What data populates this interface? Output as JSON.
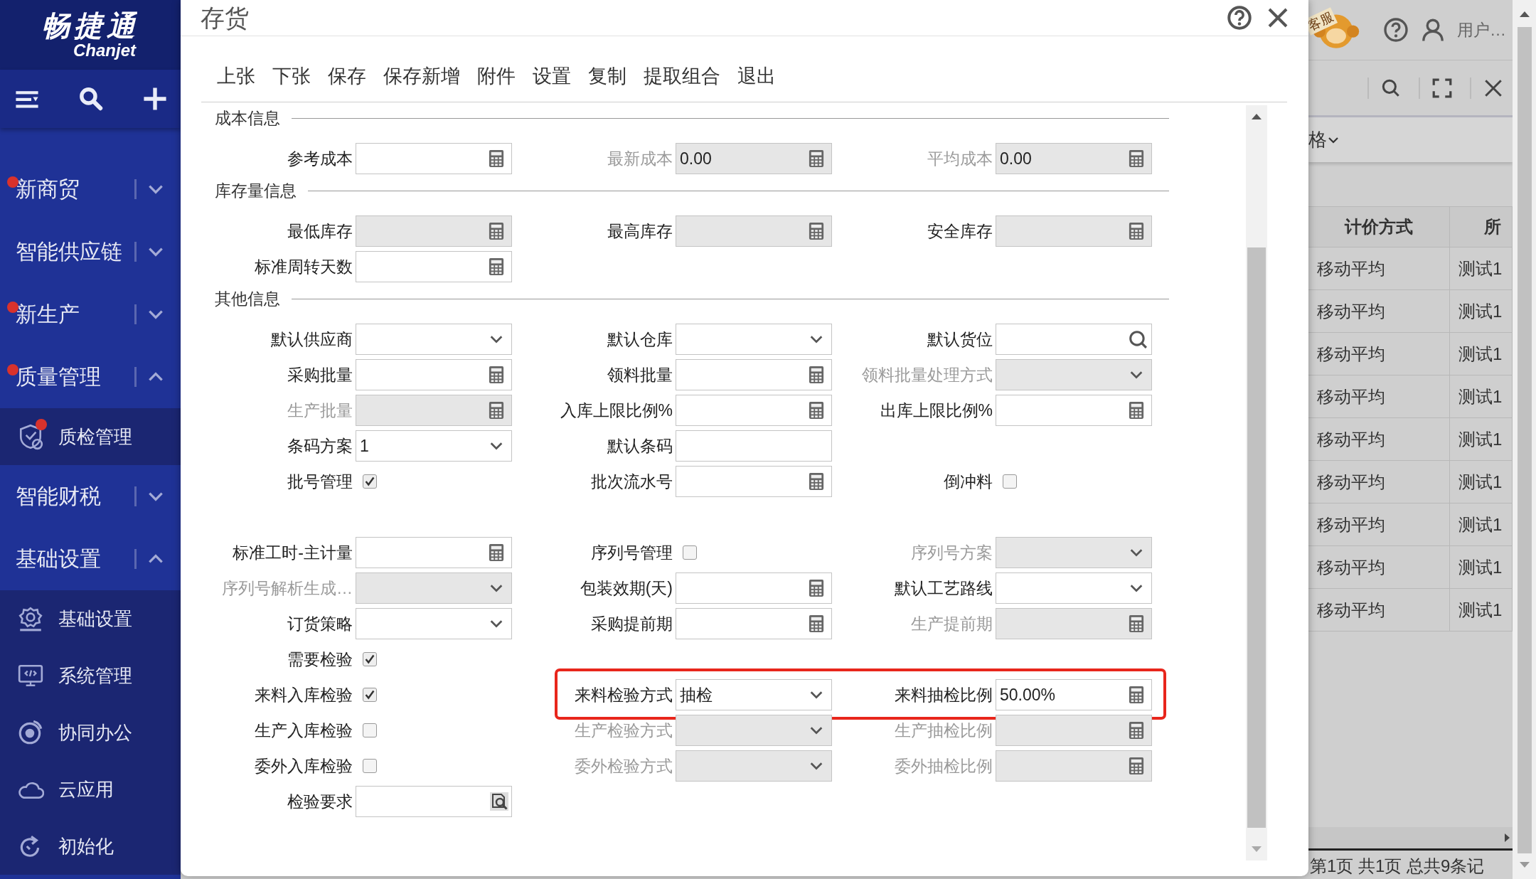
{
  "sidebar": {
    "logo": {
      "title": "畅捷通",
      "subtitle": "Chanjet"
    },
    "items": [
      {
        "label": "新商贸",
        "badge": true,
        "expanded": false
      },
      {
        "label": "智能供应链",
        "badge": false,
        "expanded": false
      },
      {
        "label": "新生产",
        "badge": true,
        "expanded": false
      },
      {
        "label": "质量管理",
        "badge": true,
        "expanded": true,
        "children": [
          {
            "label": "质检管理",
            "badge": true
          }
        ]
      },
      {
        "label": "智能财税",
        "badge": false,
        "expanded": false
      },
      {
        "label": "基础设置",
        "badge": false,
        "expanded": true,
        "children": [
          {
            "label": "基础设置",
            "badge": false
          },
          {
            "label": "系统管理",
            "badge": false
          },
          {
            "label": "协同办公",
            "badge": false
          },
          {
            "label": "云应用",
            "badge": false
          },
          {
            "label": "初始化",
            "badge": false
          }
        ]
      }
    ]
  },
  "dialog": {
    "title": "存货",
    "toolbar": [
      "上张",
      "下张",
      "保存",
      "保存新增",
      "附件",
      "设置",
      "复制",
      "提取组合",
      "退出"
    ],
    "sections": [
      {
        "title": "成本信息",
        "rows": [
          {
            "kind": "fields",
            "highlighted": false,
            "cells": [
              {
                "kind": "calc",
                "label": "参考成本",
                "disabled": false,
                "readonly": false
              },
              {
                "kind": "calc",
                "label": "最新成本",
                "value": "0.00",
                "disabled": true,
                "readonly": true
              },
              {
                "kind": "calc",
                "label": "平均成本",
                "value": "0.00",
                "disabled": true,
                "readonly": true
              }
            ]
          }
        ]
      },
      {
        "title": "库存量信息",
        "rows": [
          {
            "kind": "fields",
            "highlighted": false,
            "cells": [
              {
                "kind": "calc",
                "label": "最低库存",
                "disabled": false,
                "readonly": true
              },
              {
                "kind": "calc",
                "label": "最高库存",
                "disabled": false,
                "readonly": true
              },
              {
                "kind": "calc",
                "label": "安全库存",
                "disabled": false,
                "readonly": true
              }
            ]
          },
          {
            "kind": "fields",
            "highlighted": false,
            "cells": [
              {
                "kind": "calc",
                "label": "标准周转天数",
                "disabled": false,
                "readonly": false
              },
              {
                "kind": "empty"
              },
              {
                "kind": "empty"
              }
            ]
          }
        ]
      },
      {
        "title": "其他信息",
        "rows": [
          {
            "kind": "fields",
            "highlighted": false,
            "cells": [
              {
                "kind": "select",
                "label": "默认供应商",
                "disabled": false,
                "readonly": false
              },
              {
                "kind": "select",
                "label": "默认仓库",
                "disabled": false,
                "readonly": false
              },
              {
                "kind": "search",
                "label": "默认货位",
                "disabled": false,
                "readonly": false
              }
            ]
          },
          {
            "kind": "fields",
            "highlighted": false,
            "cells": [
              {
                "kind": "calc",
                "label": "采购批量",
                "disabled": false,
                "readonly": false
              },
              {
                "kind": "calc",
                "label": "领料批量",
                "disabled": false,
                "readonly": false
              },
              {
                "kind": "select",
                "label": "领料批量处理方式",
                "disabled": true,
                "readonly": true
              }
            ]
          },
          {
            "kind": "fields",
            "highlighted": false,
            "cells": [
              {
                "kind": "calc",
                "label": "生产批量",
                "disabled": true,
                "readonly": true
              },
              {
                "kind": "calc",
                "label": "入库上限比例%",
                "disabled": false,
                "readonly": false
              },
              {
                "kind": "calc",
                "label": "出库上限比例%",
                "disabled": false,
                "readonly": false
              }
            ]
          },
          {
            "kind": "fields",
            "highlighted": false,
            "cells": [
              {
                "kind": "select",
                "label": "条码方案",
                "value": "1",
                "disabled": false,
                "readonly": false
              },
              {
                "kind": "text",
                "label": "默认条码",
                "disabled": false,
                "readonly": false
              },
              {
                "kind": "empty"
              }
            ]
          },
          {
            "kind": "fields",
            "highlighted": false,
            "cells": [
              {
                "kind": "checkbox",
                "label": "批号管理",
                "checked": true
              },
              {
                "kind": "calc",
                "label": "批次流水号",
                "disabled": false,
                "readonly": false
              },
              {
                "kind": "checkbox",
                "label": "倒冲料",
                "checked": false
              }
            ]
          },
          {
            "kind": "spacer"
          },
          {
            "kind": "fields",
            "highlighted": false,
            "cells": [
              {
                "kind": "calc",
                "label": "标准工时-主计量",
                "disabled": false,
                "readonly": false
              },
              {
                "kind": "checkbox",
                "label": "序列号管理",
                "checked": false
              },
              {
                "kind": "select",
                "label": "序列号方案",
                "disabled": true,
                "readonly": true
              }
            ]
          },
          {
            "kind": "fields",
            "highlighted": false,
            "cells": [
              {
                "kind": "select",
                "label": "序列号解析生成…",
                "disabled": true,
                "readonly": true
              },
              {
                "kind": "calc",
                "label": "包装效期(天)",
                "disabled": false,
                "readonly": false
              },
              {
                "kind": "select",
                "label": "默认工艺路线",
                "disabled": false,
                "readonly": false
              }
            ]
          },
          {
            "kind": "fields",
            "highlighted": false,
            "cells": [
              {
                "kind": "select",
                "label": "订货策略",
                "disabled": false,
                "readonly": false
              },
              {
                "kind": "calc",
                "label": "采购提前期",
                "disabled": false,
                "readonly": false
              },
              {
                "kind": "calc",
                "label": "生产提前期",
                "disabled": true,
                "readonly": true
              }
            ]
          },
          {
            "kind": "fields",
            "highlighted": false,
            "cells": [
              {
                "kind": "checkbox",
                "label": "需要检验",
                "checked": true
              },
              {
                "kind": "empty"
              },
              {
                "kind": "empty"
              }
            ]
          },
          {
            "kind": "fields",
            "highlighted": true,
            "cells": [
              {
                "kind": "checkbox",
                "label": "来料入库检验",
                "checked": true
              },
              {
                "kind": "select",
                "label": "来料检验方式",
                "value": "抽检",
                "disabled": false,
                "readonly": false
              },
              {
                "kind": "calc",
                "label": "来料抽检比例",
                "value": "50.00%",
                "disabled": false,
                "readonly": false
              }
            ]
          },
          {
            "kind": "fields",
            "highlighted": false,
            "cells": [
              {
                "kind": "checkbox",
                "label": "生产入库检验",
                "checked": false
              },
              {
                "kind": "select",
                "label": "生产检验方式",
                "disabled": true,
                "readonly": true
              },
              {
                "kind": "calc",
                "label": "生产抽检比例",
                "disabled": true,
                "readonly": true
              }
            ]
          },
          {
            "kind": "fields",
            "highlighted": false,
            "cells": [
              {
                "kind": "checkbox",
                "label": "委外入库检验",
                "checked": false
              },
              {
                "kind": "select",
                "label": "委外检验方式",
                "disabled": true,
                "readonly": true
              },
              {
                "kind": "calc",
                "label": "委外抽检比例",
                "disabled": true,
                "readonly": true
              }
            ]
          },
          {
            "kind": "fields",
            "highlighted": false,
            "cells": [
              {
                "kind": "lookup",
                "label": "检验要求",
                "disabled": false,
                "readonly": false
              },
              {
                "kind": "empty"
              },
              {
                "kind": "empty"
              }
            ]
          }
        ]
      }
    ]
  },
  "background": {
    "header": {
      "service_badge": "客服",
      "user": "用户…"
    },
    "filter_label": "格",
    "table": {
      "columns": [
        "计价方式",
        "所"
      ],
      "rows": [
        [
          "移动平均",
          "测试1"
        ],
        [
          "移动平均",
          "测试1"
        ],
        [
          "移动平均",
          "测试1"
        ],
        [
          "移动平均",
          "测试1"
        ],
        [
          "移动平均",
          "测试1"
        ],
        [
          "移动平均",
          "测试1"
        ],
        [
          "移动平均",
          "测试1"
        ],
        [
          "移动平均",
          "测试1"
        ],
        [
          "移动平均",
          "测试1"
        ]
      ]
    },
    "footer": "第1页 共1页 总共9条记"
  }
}
